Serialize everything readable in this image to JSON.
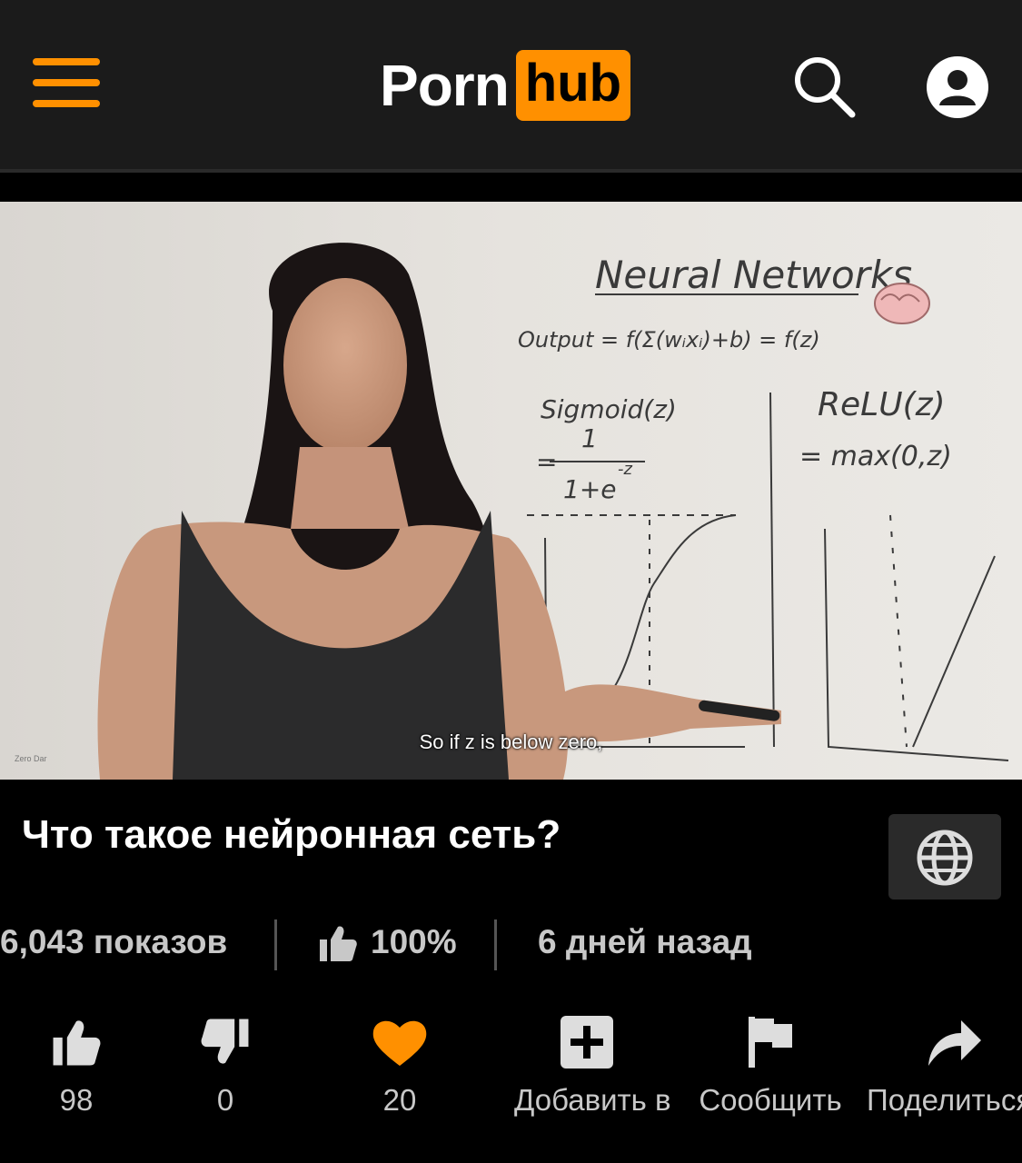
{
  "header": {
    "logo_left": "Porn",
    "logo_right": "hub",
    "accent_color": "#ff9000",
    "icons": [
      "menu-icon",
      "search-icon",
      "account-icon"
    ]
  },
  "video": {
    "whiteboard": {
      "heading": "Neural Networks",
      "output_formula": "Output = f(Σ(wᵢxᵢ)+b) = f(z)",
      "sigmoid_label": "Sigmoid(z)",
      "relu_label": "ReLU(z)",
      "relu_formula": "= max(0,z)"
    },
    "subtitle": "So if z is below zero,",
    "watermark": "Zero Dar"
  },
  "title": "Что такое нейронная сеть?",
  "stats": {
    "views": "6,043 показов",
    "rating": "100%",
    "date": "6 дней назад"
  },
  "actions": {
    "like_count": "98",
    "dislike_count": "0",
    "favorite_count": "20",
    "add_label": "Добавить в",
    "report_label": "Сообщить",
    "share_label": "Поделиться"
  }
}
